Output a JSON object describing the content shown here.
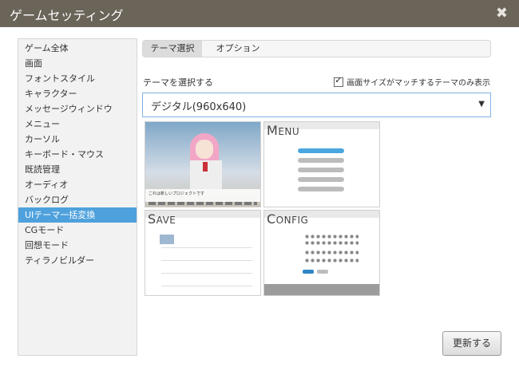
{
  "window": {
    "title": "ゲームセッティング"
  },
  "sidebar": {
    "items": [
      {
        "label": "ゲーム全体"
      },
      {
        "label": "画面"
      },
      {
        "label": "フォントスタイル"
      },
      {
        "label": "キャラクター"
      },
      {
        "label": "メッセージウィンドウ"
      },
      {
        "label": "メニュー"
      },
      {
        "label": "カーソル"
      },
      {
        "label": "キーボード・マウス"
      },
      {
        "label": "既読管理"
      },
      {
        "label": "オーディオ"
      },
      {
        "label": "バックログ"
      },
      {
        "label": "UIテーマ一括変換"
      },
      {
        "label": "CGモード"
      },
      {
        "label": "回想モード"
      },
      {
        "label": "ティラノビルダー"
      }
    ],
    "active_index": 11
  },
  "tabs": [
    {
      "label": "テーマ選択"
    },
    {
      "label": "オプション"
    }
  ],
  "theme": {
    "label": "テーマを選択する",
    "fit_checkbox_label": "画面サイズがマッチするテーマのみ表示",
    "fit_checked": true,
    "selected": "デジタル(960x640)"
  },
  "thumbnails": {
    "menu_heading": "ENU",
    "menu_cap": "M",
    "save_heading": "AVE",
    "save_cap": "S",
    "config_heading": "ONFIG",
    "config_cap": "C",
    "game_message": "これは新しいプロジェクトです"
  },
  "buttons": {
    "update": "更新する"
  },
  "colors": {
    "accent": "#4ea1dc",
    "titlebar": "#6b6459"
  }
}
